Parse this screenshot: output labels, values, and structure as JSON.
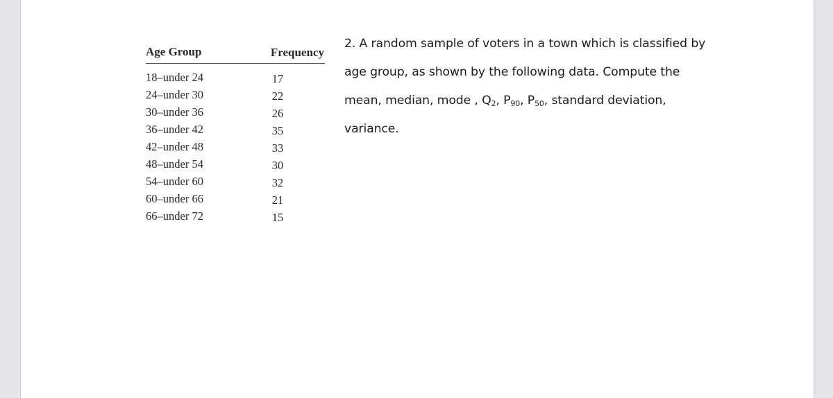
{
  "table": {
    "headers": {
      "age_group": "Age Group",
      "frequency": "Frequency"
    },
    "rows": [
      {
        "age_group": "18–under 24",
        "frequency": "17"
      },
      {
        "age_group": "24–under 30",
        "frequency": "22"
      },
      {
        "age_group": "30–under 36",
        "frequency": "26"
      },
      {
        "age_group": "36–under 42",
        "frequency": "35"
      },
      {
        "age_group": "42–under 48",
        "frequency": "33"
      },
      {
        "age_group": "48–under 54",
        "frequency": "30"
      },
      {
        "age_group": "54–under 60",
        "frequency": "32"
      },
      {
        "age_group": "60–under 66",
        "frequency": "21"
      },
      {
        "age_group": "66–under 72",
        "frequency": "15"
      }
    ]
  },
  "question": {
    "line1": "2. A random sample of voters in a town which is classified by",
    "line2": "age group, as shown by the following data. Compute the",
    "line3_a": "mean, median, mode , Q",
    "line3_q_sub": "2",
    "line3_b": ", P",
    "line3_p90_sub": "90",
    "line3_c": ", P",
    "line3_p50_sub": "50",
    "line3_d": ", standard deviation,",
    "line4": "variance."
  },
  "colors": {
    "background": "#e7e6eb",
    "page": "#fefefe",
    "text": "#1e1e1e"
  }
}
